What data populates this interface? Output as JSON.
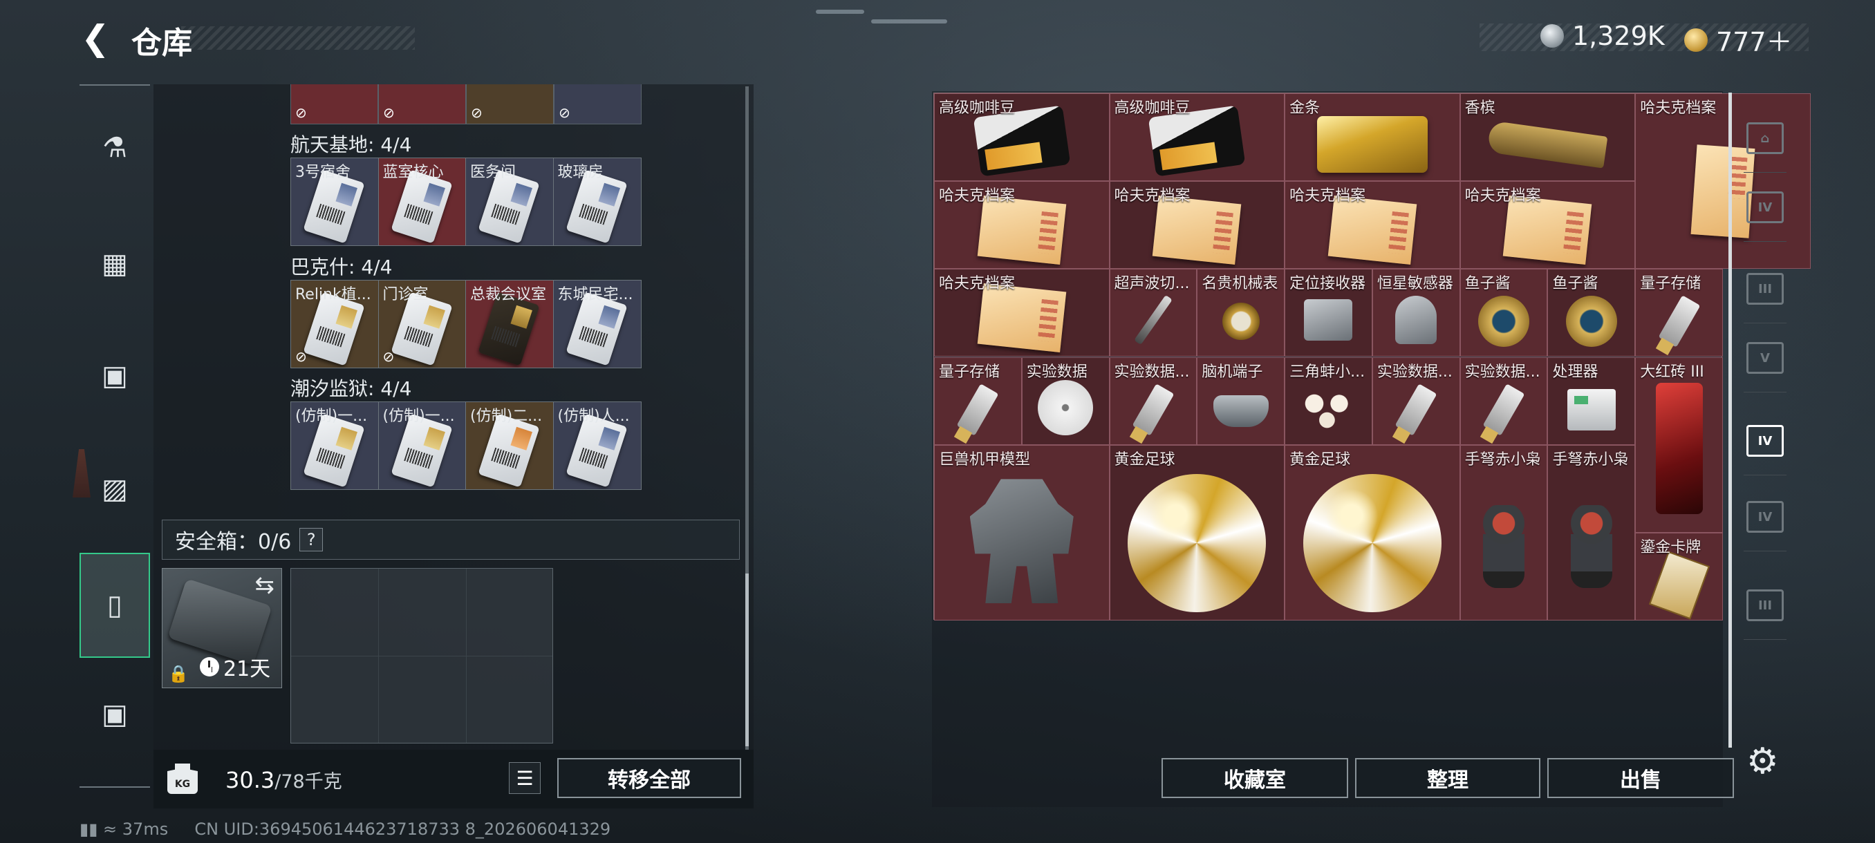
{
  "header": {
    "title": "仓库",
    "currency_silver": "1,329K",
    "currency_gold": "777＋"
  },
  "sidebar": {
    "icons": [
      "gun-icon",
      "armor-icon",
      "backpack-icon",
      "rig-icon",
      "safe-case-icon",
      "toolbox-icon"
    ],
    "active": "safe-case-icon"
  },
  "left": {
    "groups": [
      {
        "name": "航天基地: 4/4",
        "items": [
          {
            "label": "3号宿舍",
            "color": "#3a3f52",
            "variant": "blue"
          },
          {
            "label": "蓝室核心",
            "color": "#6a2b30",
            "variant": "blue"
          },
          {
            "label": "医务间",
            "color": "#3a3f52",
            "variant": "blue"
          },
          {
            "label": "玻璃房",
            "color": "#3a3f52",
            "variant": "blue"
          }
        ]
      },
      {
        "name": "巴克什: 4/4",
        "items": [
          {
            "label": "Relink植...",
            "color": "#4f3f2a",
            "variant": "gold",
            "no_icon": true
          },
          {
            "label": "门诊室",
            "color": "#4f3f2a",
            "variant": "gold",
            "no_icon": true
          },
          {
            "label": "总裁会议室",
            "color": "#6a2b30",
            "variant": "dark"
          },
          {
            "label": "东城民宅...",
            "color": "#3a3f52",
            "variant": "blue"
          }
        ]
      },
      {
        "name": "潮汐监狱: 4/4",
        "items": [
          {
            "label": "(仿制)一...",
            "color": "#3a3f52",
            "variant": "gold"
          },
          {
            "label": "(仿制)一...",
            "color": "#3a3f52",
            "variant": "gold"
          },
          {
            "label": "(仿制)二...",
            "color": "#4f3f2a",
            "variant": "orange"
          },
          {
            "label": "(仿制)人...",
            "color": "#3a3f52",
            "variant": "blue"
          }
        ]
      }
    ],
    "safebox": {
      "label": "安全箱：0/6",
      "help": "?",
      "days": "21天"
    },
    "weight": {
      "current": "30.3",
      "cap": "/78千克"
    },
    "transfer_all": "转移全部"
  },
  "right": {
    "items": [
      {
        "name": "高级咖啡豆",
        "icon": "bag"
      },
      {
        "name": "高级咖啡豆",
        "icon": "bag"
      },
      {
        "name": "金条",
        "icon": "goldbar"
      },
      {
        "name": "香槟",
        "icon": "bottle"
      },
      {
        "name": "哈夫克档案",
        "icon": "folder tall"
      },
      {
        "name": "哈夫克档案",
        "icon": "folder"
      },
      {
        "name": "哈夫克档案",
        "icon": "folder"
      },
      {
        "name": "哈夫克档案",
        "icon": "folder"
      },
      {
        "name": "哈夫克档案",
        "icon": "folder"
      },
      {
        "name": "哈夫克档案",
        "icon": "folder"
      },
      {
        "name": "超声波切...",
        "icon": "pen"
      },
      {
        "name": "名贵机械表",
        "icon": "watch"
      },
      {
        "name": "定位接收器",
        "icon": "device"
      },
      {
        "name": "恒星敏感器",
        "icon": "device cam"
      },
      {
        "name": "鱼子酱",
        "icon": "caviar"
      },
      {
        "name": "鱼子酱",
        "icon": "caviar"
      },
      {
        "name": "量子存储",
        "icon": "usb"
      },
      {
        "name": "量子存储",
        "icon": "usb"
      },
      {
        "name": "实验数据",
        "icon": "disc"
      },
      {
        "name": "实验数据...",
        "icon": "usb"
      },
      {
        "name": "脑机端子",
        "icon": "drone"
      },
      {
        "name": "三角蚌小...",
        "icon": "pearls"
      },
      {
        "name": "实验数据...",
        "icon": "usb"
      },
      {
        "name": "实验数据...",
        "icon": "usb"
      },
      {
        "name": "处理器",
        "icon": "server"
      },
      {
        "name": "大红砖 III",
        "icon": "brick"
      },
      {
        "name": "巨兽机甲模型",
        "icon": "mech"
      },
      {
        "name": "黄金足球",
        "icon": "ball"
      },
      {
        "name": "黄金足球",
        "icon": "ball"
      },
      {
        "name": "手弩赤小枭",
        "icon": "doll"
      },
      {
        "name": "手弩赤小枭",
        "icon": "doll"
      },
      {
        "name": "鎏金卡牌",
        "icon": "tarot"
      }
    ],
    "buttons": {
      "collection": "收藏室",
      "sort": "整理",
      "sell": "出售"
    },
    "tabs": [
      "base-icon",
      "IV",
      "III",
      "V",
      "IV",
      "IV",
      "III"
    ]
  },
  "status": {
    "ping": "37ms",
    "uid": "CN UID:3694506144623718733 8_202606041329"
  }
}
